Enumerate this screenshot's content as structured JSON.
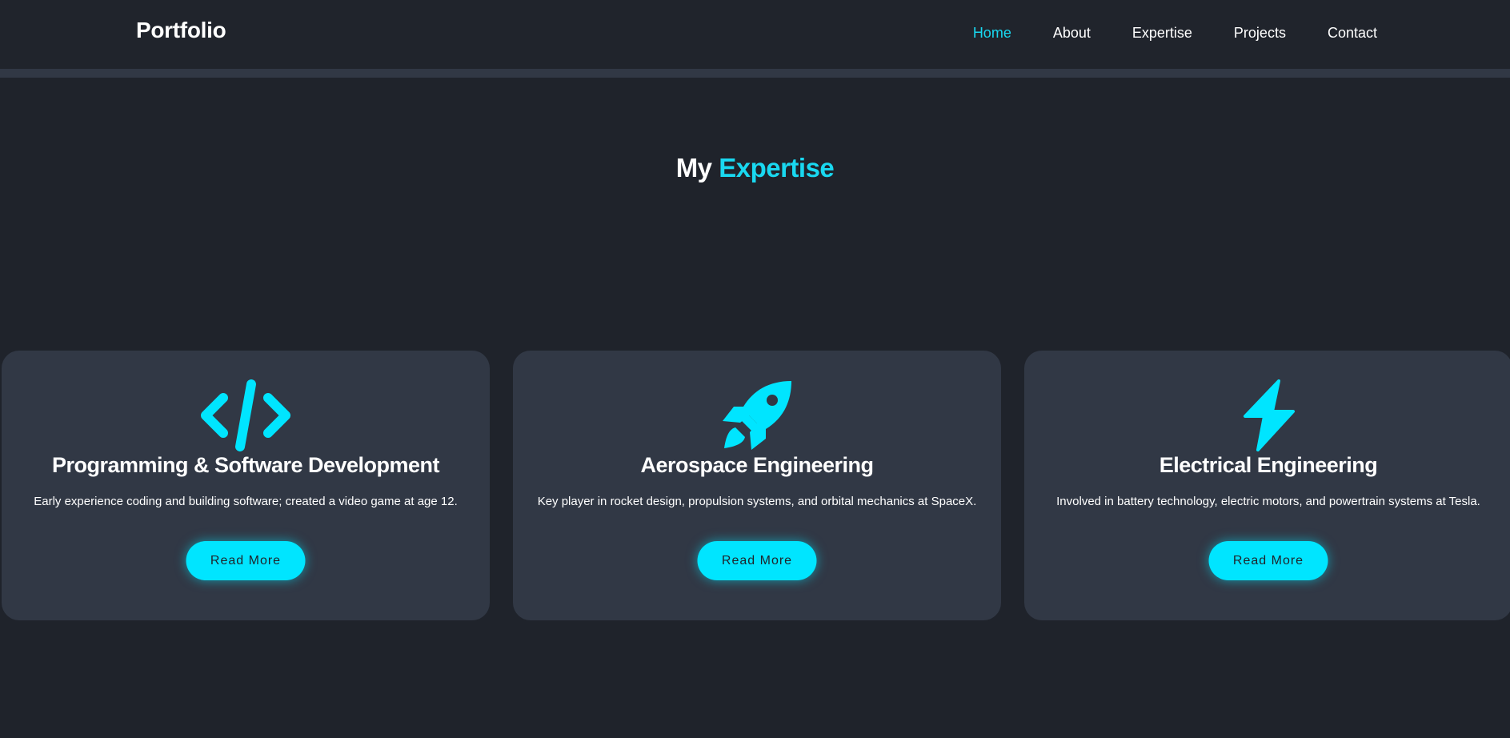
{
  "nav": {
    "brand": "Portfolio",
    "links": [
      {
        "label": "Home",
        "active": true
      },
      {
        "label": "About"
      },
      {
        "label": "Expertise"
      },
      {
        "label": "Projects"
      },
      {
        "label": "Contact"
      }
    ]
  },
  "section": {
    "title_prefix": "My",
    "title_accent": "Expertise"
  },
  "cards": [
    {
      "icon": "code-icon",
      "title": "Programming & Software Development",
      "description": "Early experience coding and building software; created a video game at age 12.",
      "button": "Read More"
    },
    {
      "icon": "rocket-icon",
      "title": "Aerospace Engineering",
      "description": "Key player in rocket design, propulsion systems, and orbital mechanics at SpaceX.",
      "button": "Read More"
    },
    {
      "icon": "lightning-icon",
      "title": "Electrical Engineering",
      "description": "Involved in battery technology, electric motors, and powertrain systems at Tesla.",
      "button": "Read More"
    }
  ],
  "colors": {
    "accent": "#00e5ff",
    "background": "#1f232b",
    "card": "#313845"
  }
}
